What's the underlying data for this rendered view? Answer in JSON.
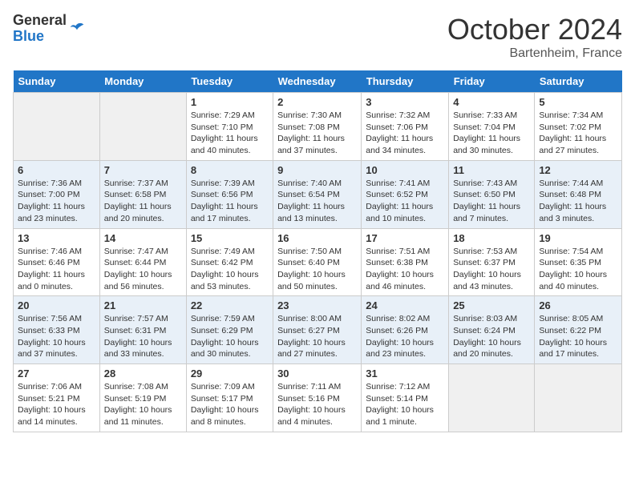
{
  "header": {
    "logo_line1": "General",
    "logo_line2": "Blue",
    "title": "October 2024",
    "subtitle": "Bartenheim, France"
  },
  "days_of_week": [
    "Sunday",
    "Monday",
    "Tuesday",
    "Wednesday",
    "Thursday",
    "Friday",
    "Saturday"
  ],
  "weeks": [
    [
      {
        "day": "",
        "info": ""
      },
      {
        "day": "",
        "info": ""
      },
      {
        "day": "1",
        "info": "Sunrise: 7:29 AM\nSunset: 7:10 PM\nDaylight: 11 hours and 40 minutes."
      },
      {
        "day": "2",
        "info": "Sunrise: 7:30 AM\nSunset: 7:08 PM\nDaylight: 11 hours and 37 minutes."
      },
      {
        "day": "3",
        "info": "Sunrise: 7:32 AM\nSunset: 7:06 PM\nDaylight: 11 hours and 34 minutes."
      },
      {
        "day": "4",
        "info": "Sunrise: 7:33 AM\nSunset: 7:04 PM\nDaylight: 11 hours and 30 minutes."
      },
      {
        "day": "5",
        "info": "Sunrise: 7:34 AM\nSunset: 7:02 PM\nDaylight: 11 hours and 27 minutes."
      }
    ],
    [
      {
        "day": "6",
        "info": "Sunrise: 7:36 AM\nSunset: 7:00 PM\nDaylight: 11 hours and 23 minutes."
      },
      {
        "day": "7",
        "info": "Sunrise: 7:37 AM\nSunset: 6:58 PM\nDaylight: 11 hours and 20 minutes."
      },
      {
        "day": "8",
        "info": "Sunrise: 7:39 AM\nSunset: 6:56 PM\nDaylight: 11 hours and 17 minutes."
      },
      {
        "day": "9",
        "info": "Sunrise: 7:40 AM\nSunset: 6:54 PM\nDaylight: 11 hours and 13 minutes."
      },
      {
        "day": "10",
        "info": "Sunrise: 7:41 AM\nSunset: 6:52 PM\nDaylight: 11 hours and 10 minutes."
      },
      {
        "day": "11",
        "info": "Sunrise: 7:43 AM\nSunset: 6:50 PM\nDaylight: 11 hours and 7 minutes."
      },
      {
        "day": "12",
        "info": "Sunrise: 7:44 AM\nSunset: 6:48 PM\nDaylight: 11 hours and 3 minutes."
      }
    ],
    [
      {
        "day": "13",
        "info": "Sunrise: 7:46 AM\nSunset: 6:46 PM\nDaylight: 11 hours and 0 minutes."
      },
      {
        "day": "14",
        "info": "Sunrise: 7:47 AM\nSunset: 6:44 PM\nDaylight: 10 hours and 56 minutes."
      },
      {
        "day": "15",
        "info": "Sunrise: 7:49 AM\nSunset: 6:42 PM\nDaylight: 10 hours and 53 minutes."
      },
      {
        "day": "16",
        "info": "Sunrise: 7:50 AM\nSunset: 6:40 PM\nDaylight: 10 hours and 50 minutes."
      },
      {
        "day": "17",
        "info": "Sunrise: 7:51 AM\nSunset: 6:38 PM\nDaylight: 10 hours and 46 minutes."
      },
      {
        "day": "18",
        "info": "Sunrise: 7:53 AM\nSunset: 6:37 PM\nDaylight: 10 hours and 43 minutes."
      },
      {
        "day": "19",
        "info": "Sunrise: 7:54 AM\nSunset: 6:35 PM\nDaylight: 10 hours and 40 minutes."
      }
    ],
    [
      {
        "day": "20",
        "info": "Sunrise: 7:56 AM\nSunset: 6:33 PM\nDaylight: 10 hours and 37 minutes."
      },
      {
        "day": "21",
        "info": "Sunrise: 7:57 AM\nSunset: 6:31 PM\nDaylight: 10 hours and 33 minutes."
      },
      {
        "day": "22",
        "info": "Sunrise: 7:59 AM\nSunset: 6:29 PM\nDaylight: 10 hours and 30 minutes."
      },
      {
        "day": "23",
        "info": "Sunrise: 8:00 AM\nSunset: 6:27 PM\nDaylight: 10 hours and 27 minutes."
      },
      {
        "day": "24",
        "info": "Sunrise: 8:02 AM\nSunset: 6:26 PM\nDaylight: 10 hours and 23 minutes."
      },
      {
        "day": "25",
        "info": "Sunrise: 8:03 AM\nSunset: 6:24 PM\nDaylight: 10 hours and 20 minutes."
      },
      {
        "day": "26",
        "info": "Sunrise: 8:05 AM\nSunset: 6:22 PM\nDaylight: 10 hours and 17 minutes."
      }
    ],
    [
      {
        "day": "27",
        "info": "Sunrise: 7:06 AM\nSunset: 5:21 PM\nDaylight: 10 hours and 14 minutes."
      },
      {
        "day": "28",
        "info": "Sunrise: 7:08 AM\nSunset: 5:19 PM\nDaylight: 10 hours and 11 minutes."
      },
      {
        "day": "29",
        "info": "Sunrise: 7:09 AM\nSunset: 5:17 PM\nDaylight: 10 hours and 8 minutes."
      },
      {
        "day": "30",
        "info": "Sunrise: 7:11 AM\nSunset: 5:16 PM\nDaylight: 10 hours and 4 minutes."
      },
      {
        "day": "31",
        "info": "Sunrise: 7:12 AM\nSunset: 5:14 PM\nDaylight: 10 hours and 1 minute."
      },
      {
        "day": "",
        "info": ""
      },
      {
        "day": "",
        "info": ""
      }
    ]
  ]
}
